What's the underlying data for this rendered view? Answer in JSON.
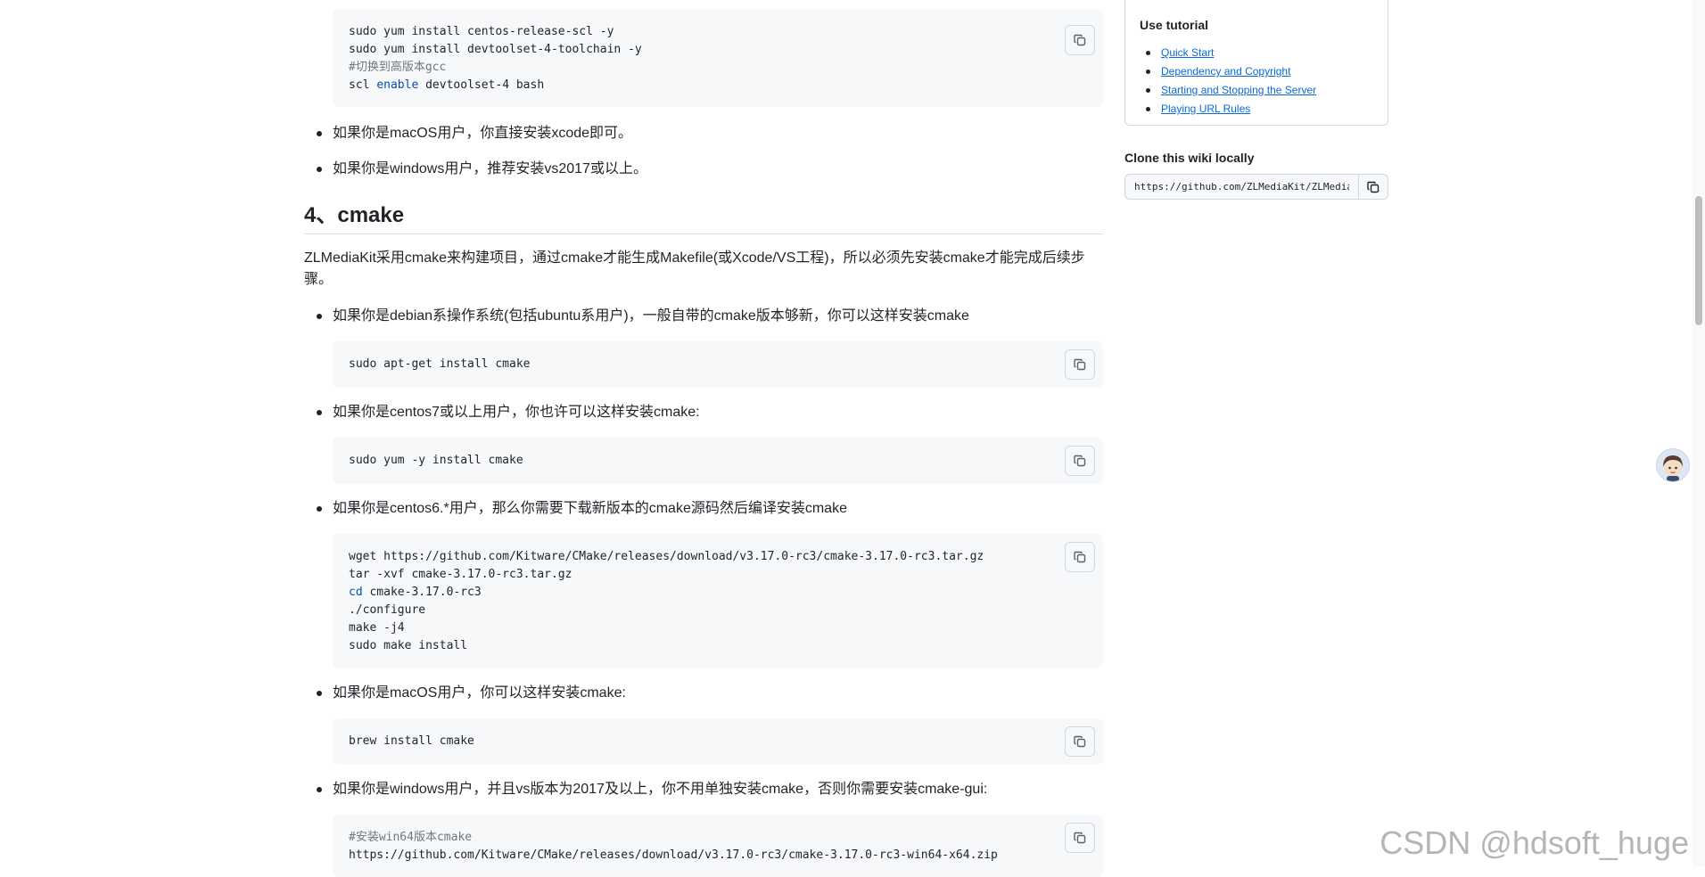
{
  "article": {
    "code_top": {
      "lines": [
        "sudo yum install centos-release-scl -y",
        "sudo yum install devtoolset-4-toolchain -y",
        "#切换到高版本gcc"
      ],
      "last_line": {
        "prefix": "scl ",
        "keyword": "enable",
        "suffix": " devtoolset-4 bash"
      }
    },
    "bullet_macos_xcode": "如果你是macOS用户，你直接安装xcode即可。",
    "bullet_windows_vs": "如果你是windows用户，推荐安装vs2017或以上。",
    "section_heading": "4、cmake",
    "section_intro": "ZLMediaKit采用cmake来构建项目，通过cmake才能生成Makefile(或Xcode/VS工程)，所以必须先安装cmake才能完成后续步骤。",
    "bullet_debian": "如果你是debian系操作系统(包括ubuntu系用户)，一般自带的cmake版本够新，你可以这样安装cmake",
    "code_debian": "sudo apt-get install cmake",
    "bullet_centos7": "如果你是centos7或以上用户，你也许可以这样安装cmake:",
    "code_centos7": "sudo yum -y install cmake",
    "bullet_centos6": "如果你是centos6.*用户，那么你需要下载新版本的cmake源码然后编译安装cmake",
    "code_centos6": {
      "line1": "wget https://github.com/Kitware/CMake/releases/download/v3.17.0-rc3/cmake-3.17.0-rc3.tar.gz",
      "line2": "tar -xvf cmake-3.17.0-rc3.tar.gz",
      "line3_keyword": "cd",
      "line3_rest": " cmake-3.17.0-rc3",
      "line4": "./configure",
      "line5": "make -j4",
      "line6": "sudo make install"
    },
    "bullet_macos_cmake": "如果你是macOS用户，你可以这样安装cmake:",
    "code_macos": "brew install cmake",
    "bullet_windows_cmake": "如果你是windows用户，并且vs版本为2017及以上，你不用单独安装cmake，否则你需要安装cmake-gui:",
    "code_windows": {
      "comment": "#安装win64版本cmake",
      "url": "https://github.com/Kitware/CMake/releases/download/v3.17.0-rc3/cmake-3.17.0-rc3-win64-x64.zip"
    }
  },
  "sidebar": {
    "tutorial_title": "Use tutorial",
    "tutorial_links": [
      "Quick Start",
      "Dependency and Copyright",
      "Starting and Stopping the Server",
      "Playing URL Rules"
    ],
    "clone_title": "Clone this wiki locally",
    "clone_url": "https://github.com/ZLMediaKit/ZLMediaKit.wiki.git"
  },
  "icons": {
    "copy": "copy-icon",
    "avatar": "assistant-avatar-icon"
  },
  "watermark": "CSDN @hdsoft_huge"
}
